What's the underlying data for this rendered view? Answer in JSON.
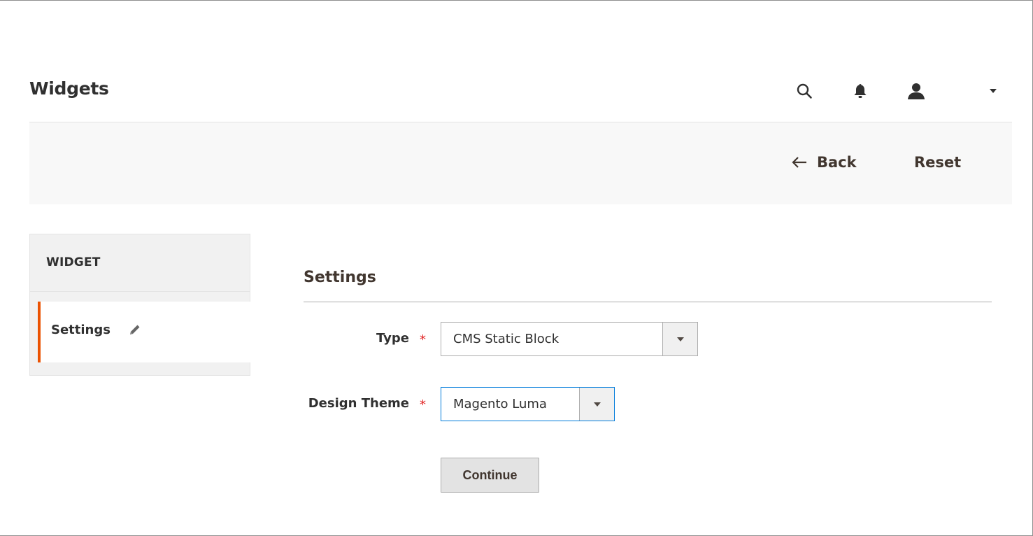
{
  "header": {
    "title": "Widgets",
    "icons": [
      "search-icon",
      "bell-icon",
      "user-icon",
      "caret-down-icon"
    ]
  },
  "action_bar": {
    "back_label": "Back",
    "reset_label": "Reset"
  },
  "sidebar": {
    "title": "WIDGET",
    "items": [
      {
        "label": "Settings",
        "active": true,
        "icon": "pencil-icon"
      }
    ],
    "accent_color": "#eb5202"
  },
  "main": {
    "section_title": "Settings",
    "fields": {
      "type": {
        "label": "Type",
        "required_mark": "*",
        "value": "CMS Static Block"
      },
      "design_theme": {
        "label": "Design Theme",
        "required_mark": "*",
        "value": "Magento Luma"
      }
    },
    "continue_label": "Continue"
  },
  "colors": {
    "required": "#e22626",
    "focus_border": "#007bdb",
    "action_bar_bg": "#f8f8f8"
  }
}
